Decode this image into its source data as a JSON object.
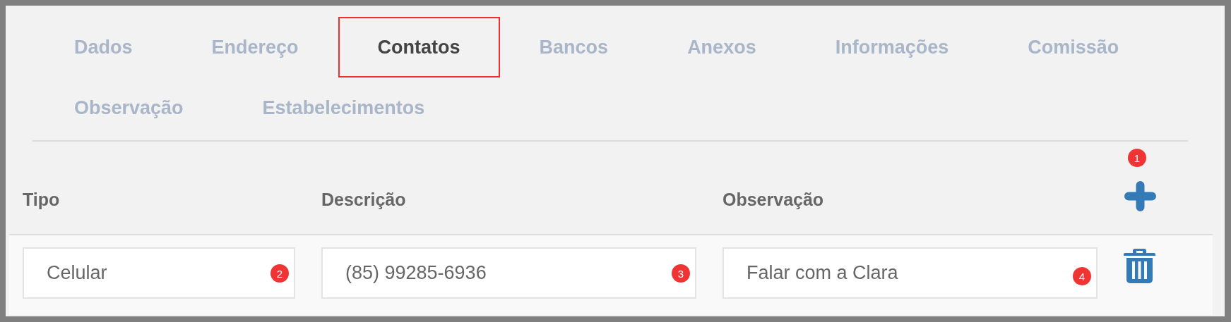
{
  "tabs": [
    {
      "label": "Dados",
      "selected": false
    },
    {
      "label": "Endereço",
      "selected": false
    },
    {
      "label": "Contatos",
      "selected": true
    },
    {
      "label": "Bancos",
      "selected": false
    },
    {
      "label": "Anexos",
      "selected": false
    },
    {
      "label": "Informações",
      "selected": false
    },
    {
      "label": "Comissão",
      "selected": false
    },
    {
      "label": "Observação",
      "selected": false
    },
    {
      "label": "Estabelecimentos",
      "selected": false
    }
  ],
  "table": {
    "columns": [
      {
        "label": "Tipo"
      },
      {
        "label": "Descrição"
      },
      {
        "label": "Observação"
      }
    ],
    "add_button": {
      "badge": "1"
    },
    "rows": [
      {
        "cells": [
          {
            "value": "Celular",
            "badge": "2"
          },
          {
            "value": "(85) 99285-6936",
            "badge": "3"
          },
          {
            "value": "Falar com a Clara",
            "badge": "4"
          }
        ]
      }
    ]
  }
}
